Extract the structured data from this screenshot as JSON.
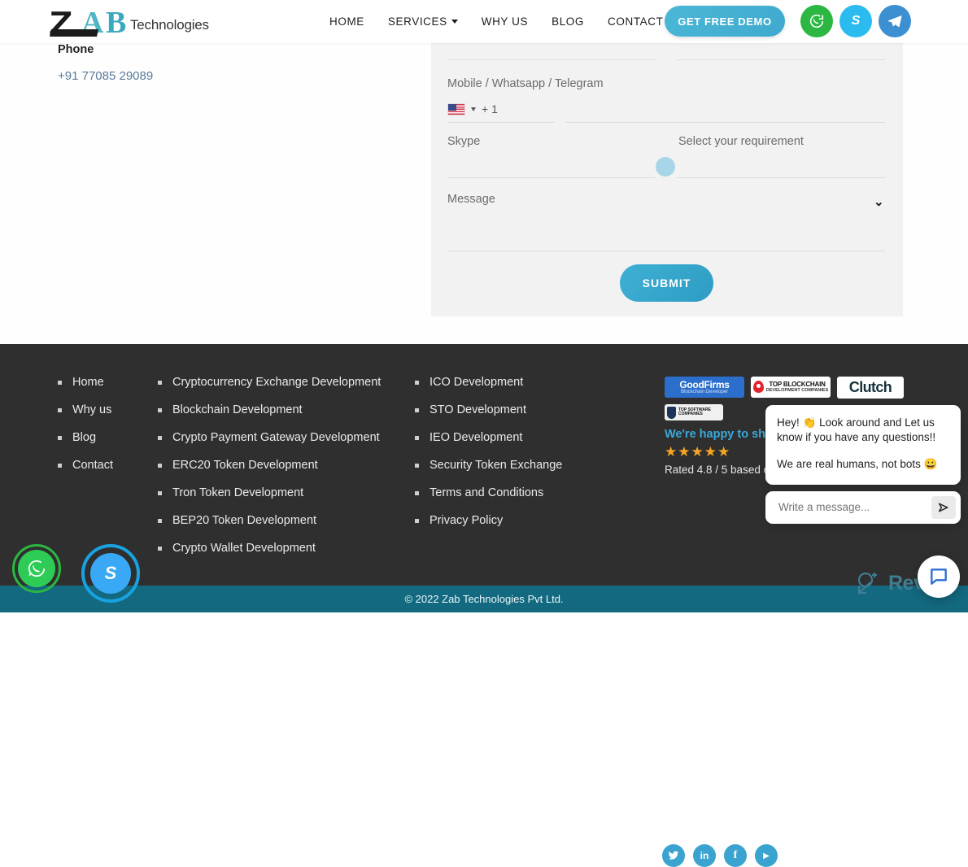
{
  "header": {
    "logo": {
      "z": "Z",
      "a": "A",
      "b": "B",
      "suffix": "Technologies"
    },
    "nav": [
      {
        "label": "HOME",
        "has_caret": false
      },
      {
        "label": "SERVICES",
        "has_caret": true
      },
      {
        "label": "WHY US",
        "has_caret": false
      },
      {
        "label": "BLOG",
        "has_caret": false
      },
      {
        "label": "CONTACT",
        "has_caret": false
      }
    ],
    "demo_button": "GET FREE DEMO",
    "social": [
      "whatsapp-icon",
      "skype-icon",
      "telegram-icon"
    ]
  },
  "contact": {
    "phone_label": "Phone",
    "phone_value": "+91 77085 29089"
  },
  "form": {
    "mobile_label": "Mobile / Whatsapp / Telegram",
    "dial_code": "+ 1",
    "country_flag": "us-flag-icon",
    "skype_label": "Skype",
    "requirement_label": "Select your requirement",
    "message_label": "Message",
    "submit_label": "SUBMIT"
  },
  "footer": {
    "col1": [
      "Home",
      "Why us",
      "Blog",
      "Contact"
    ],
    "col2": [
      "Cryptocurrency Exchange Development",
      "Blockchain Development",
      "Crypto Payment Gateway Development",
      "ERC20 Token Development",
      "Tron Token Development",
      "BEP20 Token Development",
      "Crypto Wallet Development"
    ],
    "col3": [
      "ICO Development",
      "STO Development",
      "IEO Development",
      "Security Token Exchange",
      "Terms and Conditions",
      "Privacy Policy"
    ],
    "badges": {
      "goodfirms_top": "GoodFirms",
      "goodfirms_sub": "Blockchain Developer",
      "topblockchain_top": "TOP BLOCKCHAIN",
      "topblockchain_sub": "DEVELOPMENT COMPANIES",
      "clutch": "Clutch",
      "topsoftware": "TOP SOFTWARE COMPANIES"
    },
    "happy_text": "We're happy to share",
    "stars": "★★★★★",
    "rated_text": "Rated 4.8 / 5 based on",
    "social": [
      "twitter-icon",
      "linkedin-icon",
      "facebook-icon",
      "youtube-icon"
    ],
    "copyright": "© 2022 Zab Technologies Pvt Ltd."
  },
  "chat": {
    "message_1": "Hey! 👏 Look around and Let us know if you have any questions!!",
    "message_2": "We are real humans, not bots 😀",
    "input_placeholder": "Write a message...",
    "send_icon": "send-icon"
  },
  "watermark": {
    "text": "Revain"
  },
  "colors": {
    "accent": "#3aa8d8",
    "footer_bg": "#2f2f2f",
    "bottom_bar": "#13697f",
    "star": "#f5a623"
  }
}
